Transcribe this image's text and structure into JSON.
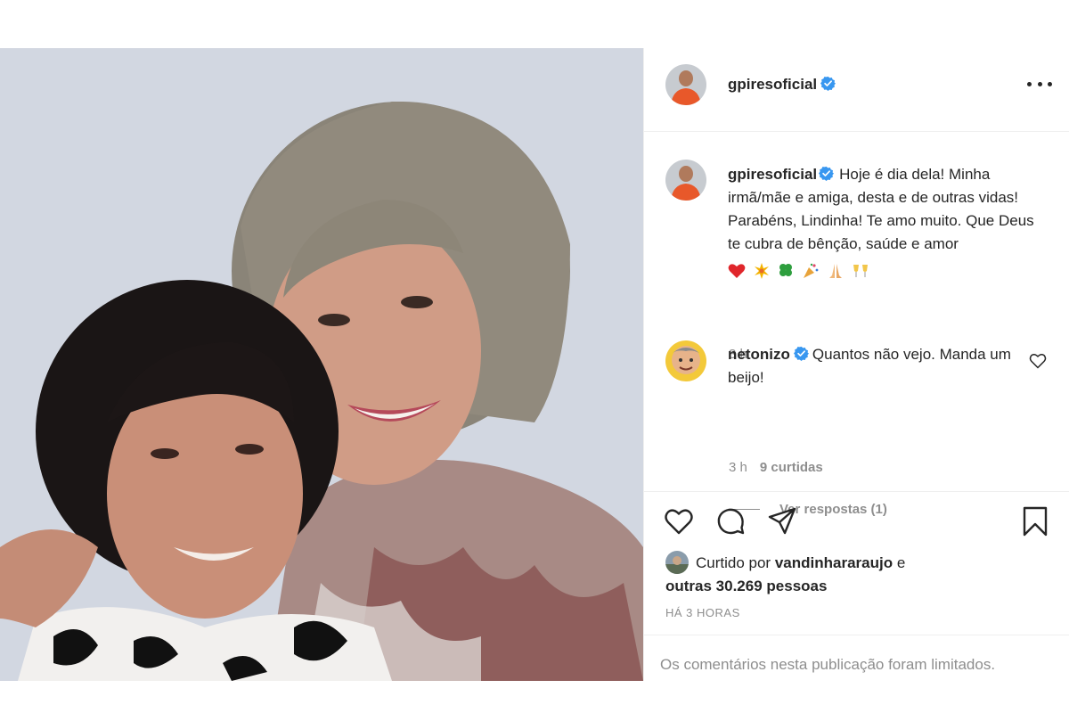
{
  "post": {
    "username": "gpiresoficial",
    "verified": true,
    "more_label": "More options",
    "photo_alt": "Selfie of two women smiling"
  },
  "caption": {
    "username": "gpiresoficial",
    "text": "Hoje é dia dela! Minha irmã/mãe e amiga, desta e de outras vidas! Parabéns, Lindinha! Te amo muito. Que Deus te cubra de bênção, saúde e amor",
    "emojis": [
      "red-heart",
      "sparkle",
      "four-leaf-clover",
      "party-popper",
      "folded-hands",
      "clinking-glasses"
    ],
    "time": "3 h"
  },
  "comment": {
    "username": "netonizo",
    "text": "Quantos não vejo. Manda um beijo!",
    "time": "3 h",
    "likes": "9 curtidas",
    "view_replies": "Ver respostas (1)"
  },
  "actions": {
    "icons": [
      "heart-icon",
      "comment-icon",
      "share-icon",
      "bookmark-icon"
    ]
  },
  "liked_by": {
    "prefix": "Curtido por",
    "user": "vandinhararaujo",
    "joiner": "e",
    "others": "outras 30.269 pessoas"
  },
  "timestamp": "HÁ 3 HORAS",
  "comments_limited": "Os comentários nesta publicação foram limitados.",
  "colors": {
    "verified": "#3897f0",
    "text": "#262626",
    "muted": "#8e8e8e",
    "border": "#efefef",
    "heart": "#ed4956"
  }
}
